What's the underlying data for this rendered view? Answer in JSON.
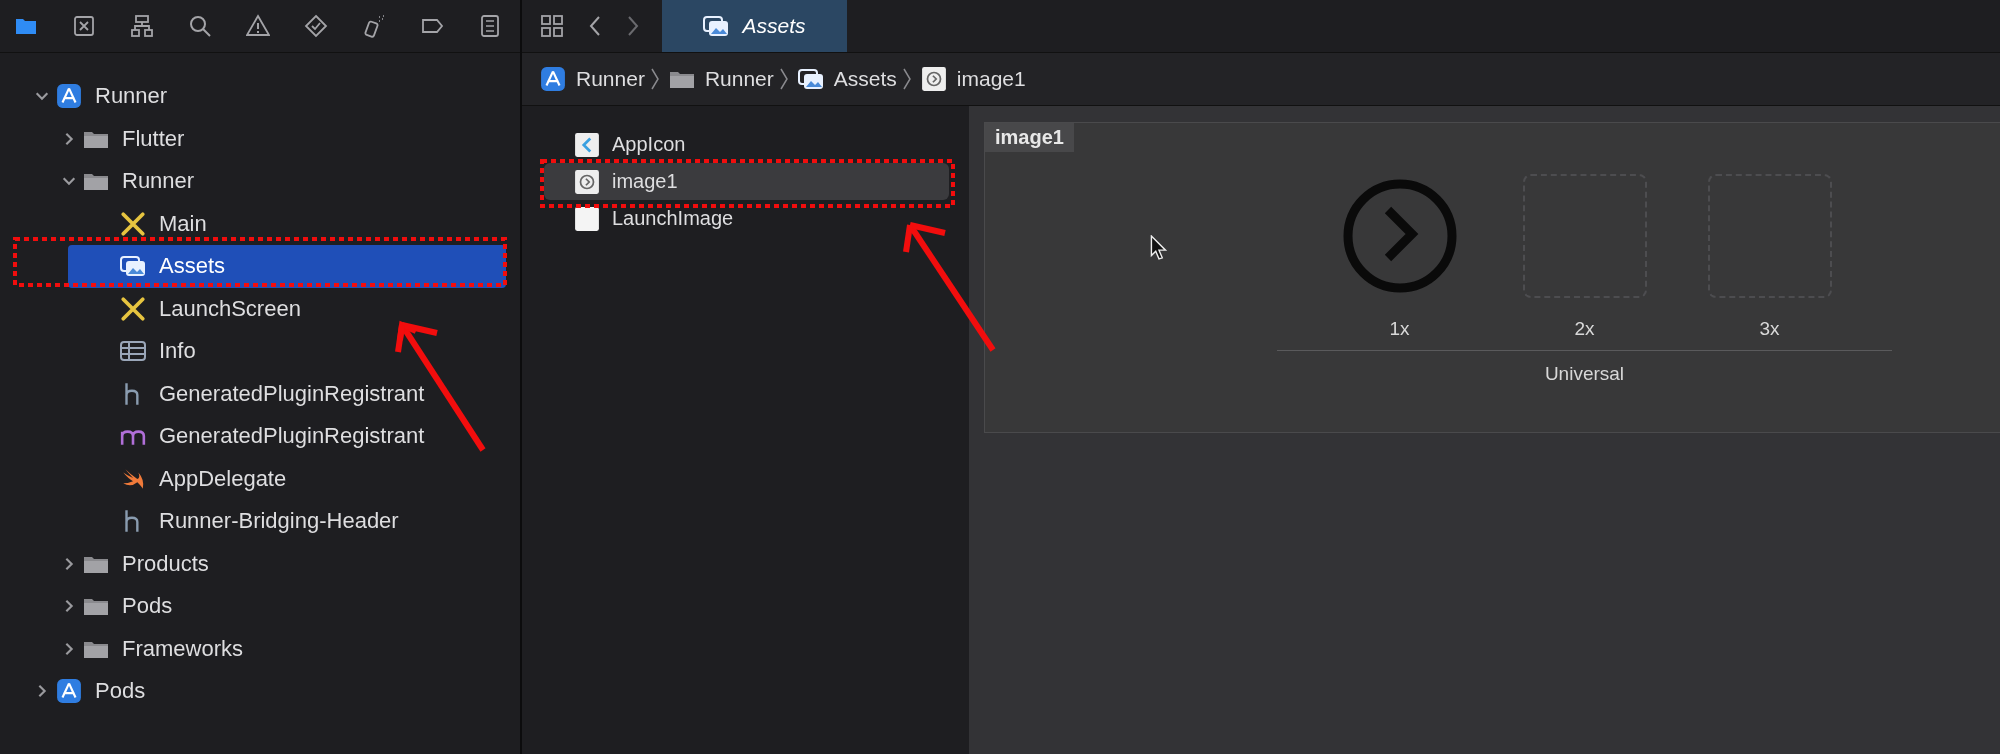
{
  "navigator_tabs": [
    {
      "kind": "folder",
      "selected": true
    },
    {
      "kind": "source-control",
      "selected": false
    },
    {
      "kind": "hierarchy",
      "selected": false
    },
    {
      "kind": "search",
      "selected": false
    },
    {
      "kind": "warning",
      "selected": false
    },
    {
      "kind": "test",
      "selected": false
    },
    {
      "kind": "debug",
      "selected": false
    },
    {
      "kind": "breakpoint",
      "selected": false
    },
    {
      "kind": "report",
      "selected": false
    }
  ],
  "tree": [
    {
      "label": "Runner",
      "kind": "project",
      "expanded": true,
      "selected": false,
      "children": [
        {
          "label": "Flutter",
          "kind": "folder",
          "expanded": false,
          "selected": false
        },
        {
          "label": "Runner",
          "kind": "folder",
          "expanded": true,
          "selected": false,
          "children": [
            {
              "label": "Main",
              "kind": "storyboard",
              "selected": false
            },
            {
              "label": "Assets",
              "kind": "assets",
              "selected": true
            },
            {
              "label": "LaunchScreen",
              "kind": "storyboard",
              "selected": false
            },
            {
              "label": "Info",
              "kind": "plist",
              "selected": false
            },
            {
              "label": "GeneratedPluginRegistrant",
              "kind": "header",
              "selected": false
            },
            {
              "label": "GeneratedPluginRegistrant",
              "kind": "objc",
              "selected": false
            },
            {
              "label": "AppDelegate",
              "kind": "swift",
              "selected": false
            },
            {
              "label": "Runner-Bridging-Header",
              "kind": "header",
              "selected": false
            }
          ]
        },
        {
          "label": "Products",
          "kind": "folder",
          "expanded": false,
          "selected": false
        },
        {
          "label": "Pods",
          "kind": "folder",
          "expanded": false,
          "selected": false
        },
        {
          "label": "Frameworks",
          "kind": "folder",
          "expanded": false,
          "selected": false
        }
      ]
    },
    {
      "label": "Pods",
      "kind": "project",
      "expanded": false,
      "selected": false
    }
  ],
  "editor_tab": {
    "label": "Assets",
    "selected": true
  },
  "breadcrumbs": [
    {
      "label": "Runner",
      "kind": "project"
    },
    {
      "label": "Runner",
      "kind": "folder"
    },
    {
      "label": "Assets",
      "kind": "assets"
    },
    {
      "label": "image1",
      "kind": "imageset"
    }
  ],
  "asset_list": [
    {
      "label": "AppIcon",
      "kind": "appicon",
      "selected": false
    },
    {
      "label": "image1",
      "kind": "imageset",
      "selected": true
    },
    {
      "label": "LaunchImage",
      "kind": "launch",
      "selected": false
    }
  ],
  "image_set": {
    "name": "image1",
    "slots": [
      {
        "label": "1x",
        "filled": true
      },
      {
        "label": "2x",
        "filled": false
      },
      {
        "label": "3x",
        "filled": false
      }
    ],
    "group": "Universal"
  }
}
